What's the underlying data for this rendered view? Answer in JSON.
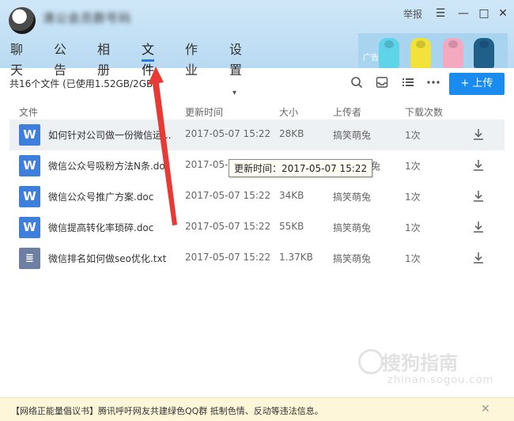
{
  "header": {
    "group_name": "清公会员群号码",
    "report": "举报",
    "window_buttons": {
      "menu": "☰",
      "minimize": "—",
      "maximize": "□",
      "close": "✕"
    },
    "tabs": [
      {
        "label": "聊天",
        "active": false
      },
      {
        "label": "公告",
        "active": false
      },
      {
        "label": "相册",
        "active": false
      },
      {
        "label": "文件",
        "active": true
      },
      {
        "label": "作业",
        "active": false
      },
      {
        "label": "设置",
        "active": false,
        "has_caret": true
      }
    ],
    "ad_label": "广告"
  },
  "toolbar": {
    "summary": "共16个文件 (已使用1.52GB/2GB)",
    "upload_label": "+ 上传",
    "icons": [
      "search-icon",
      "inbox-icon",
      "list-view-icon",
      "more-icon"
    ]
  },
  "table": {
    "columns": [
      "文件",
      "更新时间",
      "大小",
      "上传者",
      "下载次数"
    ],
    "rows": [
      {
        "icon": "W",
        "type": "doc",
        "name": "如何针对公司做一份微信运...",
        "time": "2017-05-07 15:22",
        "size": "28KB",
        "uploader": "搞笑萌兔",
        "downloads": "1次"
      },
      {
        "icon": "W",
        "type": "doc",
        "name": "微信公众号吸粉方法N条.doc",
        "time": "2017-05-0",
        "size": "",
        "uploader": "兔",
        "downloads": "1次"
      },
      {
        "icon": "W",
        "type": "doc",
        "name": "微信公众号推广方案.doc",
        "time": "2017-05-07 15:22",
        "size": "34KB",
        "uploader": "搞笑萌兔",
        "downloads": "1次"
      },
      {
        "icon": "W",
        "type": "doc",
        "name": "微信提高转化率琐碎.doc",
        "time": "2017-05-07 15:22",
        "size": "55KB",
        "uploader": "搞笑萌兔",
        "downloads": "1次"
      },
      {
        "icon": "≣",
        "type": "txt",
        "name": "微信排名如何做seo优化.txt",
        "time": "2017-05-07 15:22",
        "size": "1.37KB",
        "uploader": "搞笑萌兔",
        "downloads": "1次"
      }
    ],
    "tooltip": "更新时间：2017-05-07 15:22"
  },
  "watermark": {
    "logo": "搜狗指南",
    "url": "zhinan.sogou.com"
  },
  "footer": {
    "notice": "【网络正能量倡议书】腾讯呼吁网友共建绿色QQ群 抵制色情、反动等违法信息。",
    "close": "✕"
  },
  "colors": {
    "accent": "#1a8cf0",
    "tab_underline": "#2a7ad8",
    "arrow": "#e83a34",
    "header_bg": "#c4e0f5"
  }
}
